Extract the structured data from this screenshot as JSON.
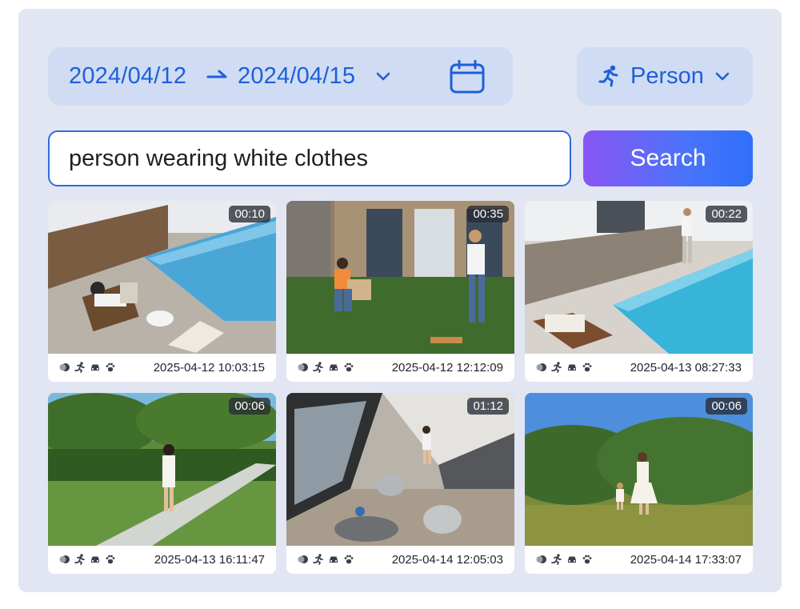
{
  "filters": {
    "date_start": "2024/04/12",
    "date_end": "2024/04/15",
    "object_type": "Person"
  },
  "search": {
    "query": "person wearing white clothes",
    "button_label": "Search"
  },
  "colors": {
    "accent": "#1e5fd8",
    "chip_bg": "#cfdcf3",
    "panel_bg": "#e1e6f2"
  },
  "results": [
    {
      "duration": "00:10",
      "timestamp": "2025-04-12 10:03:15",
      "scene": "pool-lounger"
    },
    {
      "duration": "00:35",
      "timestamp": "2025-04-12 12:12:09",
      "scene": "lawn-family"
    },
    {
      "duration": "00:22",
      "timestamp": "2025-04-13 08:27:33",
      "scene": "pool-walk"
    },
    {
      "duration": "00:06",
      "timestamp": "2025-04-13 16:11:47",
      "scene": "garden-path"
    },
    {
      "duration": "01:12",
      "timestamp": "2025-04-14 12:05:03",
      "scene": "living-room"
    },
    {
      "duration": "00:06",
      "timestamp": "2025-04-14 17:33:07",
      "scene": "field-running"
    }
  ],
  "detection_icons": [
    "motion-icon",
    "person-icon",
    "vehicle-icon",
    "pet-icon"
  ]
}
